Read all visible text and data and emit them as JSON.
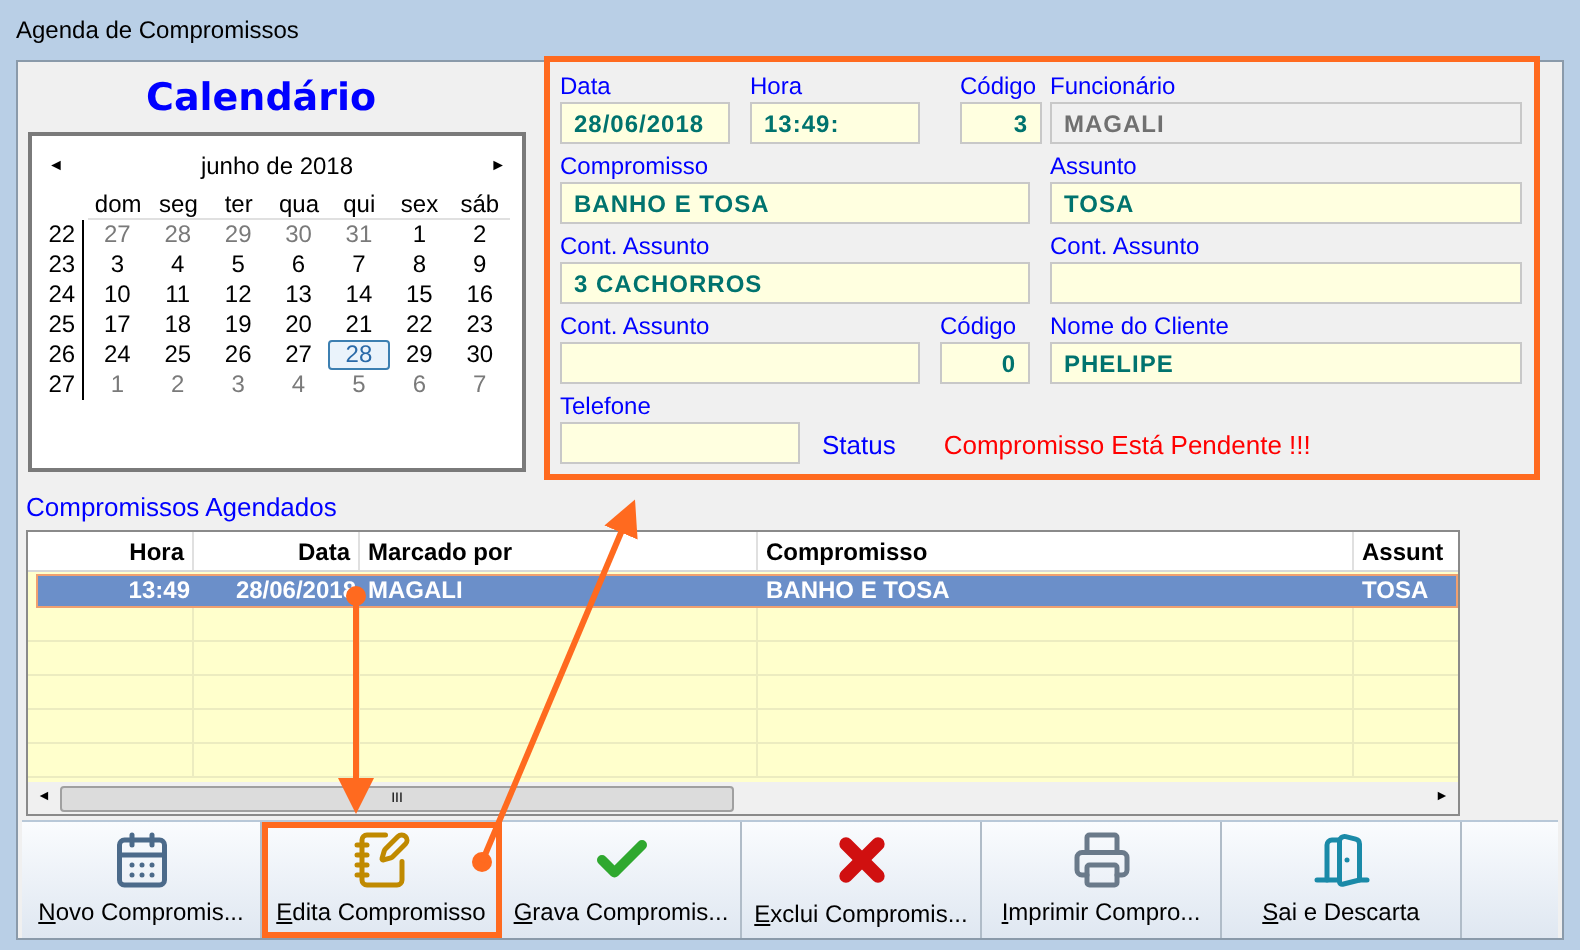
{
  "window": {
    "title": "Agenda de Compromissos"
  },
  "calendar": {
    "heading": "Calendário",
    "month": "junho de 2018",
    "prev": "◄",
    "next": "►",
    "weekdays": [
      "dom",
      "seg",
      "ter",
      "qua",
      "qui",
      "sex",
      "sáb"
    ],
    "weeks": [
      {
        "number": "22",
        "days": [
          {
            "day": "27",
            "other_month": true,
            "selected": false
          },
          {
            "day": "28",
            "other_month": true,
            "selected": false
          },
          {
            "day": "29",
            "other_month": true,
            "selected": false
          },
          {
            "day": "30",
            "other_month": true,
            "selected": false
          },
          {
            "day": "31",
            "other_month": true,
            "selected": false
          },
          {
            "day": "1",
            "other_month": false,
            "selected": false
          },
          {
            "day": "2",
            "other_month": false,
            "selected": false
          }
        ]
      },
      {
        "number": "23",
        "days": [
          {
            "day": "3",
            "other_month": false,
            "selected": false
          },
          {
            "day": "4",
            "other_month": false,
            "selected": false
          },
          {
            "day": "5",
            "other_month": false,
            "selected": false
          },
          {
            "day": "6",
            "other_month": false,
            "selected": false
          },
          {
            "day": "7",
            "other_month": false,
            "selected": false
          },
          {
            "day": "8",
            "other_month": false,
            "selected": false
          },
          {
            "day": "9",
            "other_month": false,
            "selected": false
          }
        ]
      },
      {
        "number": "24",
        "days": [
          {
            "day": "10",
            "other_month": false,
            "selected": false
          },
          {
            "day": "11",
            "other_month": false,
            "selected": false
          },
          {
            "day": "12",
            "other_month": false,
            "selected": false
          },
          {
            "day": "13",
            "other_month": false,
            "selected": false
          },
          {
            "day": "14",
            "other_month": false,
            "selected": false
          },
          {
            "day": "15",
            "other_month": false,
            "selected": false
          },
          {
            "day": "16",
            "other_month": false,
            "selected": false
          }
        ]
      },
      {
        "number": "25",
        "days": [
          {
            "day": "17",
            "other_month": false,
            "selected": false
          },
          {
            "day": "18",
            "other_month": false,
            "selected": false
          },
          {
            "day": "19",
            "other_month": false,
            "selected": false
          },
          {
            "day": "20",
            "other_month": false,
            "selected": false
          },
          {
            "day": "21",
            "other_month": false,
            "selected": false
          },
          {
            "day": "22",
            "other_month": false,
            "selected": false
          },
          {
            "day": "23",
            "other_month": false,
            "selected": false
          }
        ]
      },
      {
        "number": "26",
        "days": [
          {
            "day": "24",
            "other_month": false,
            "selected": false
          },
          {
            "day": "25",
            "other_month": false,
            "selected": false
          },
          {
            "day": "26",
            "other_month": false,
            "selected": false
          },
          {
            "day": "27",
            "other_month": false,
            "selected": false
          },
          {
            "day": "28",
            "other_month": false,
            "selected": true
          },
          {
            "day": "29",
            "other_month": false,
            "selected": false
          },
          {
            "day": "30",
            "other_month": false,
            "selected": false
          }
        ]
      },
      {
        "number": "27",
        "days": [
          {
            "day": "1",
            "other_month": true,
            "selected": false
          },
          {
            "day": "2",
            "other_month": true,
            "selected": false
          },
          {
            "day": "3",
            "other_month": true,
            "selected": false
          },
          {
            "day": "4",
            "other_month": true,
            "selected": false
          },
          {
            "day": "5",
            "other_month": true,
            "selected": false
          },
          {
            "day": "6",
            "other_month": true,
            "selected": false
          },
          {
            "day": "7",
            "other_month": true,
            "selected": false
          }
        ]
      }
    ]
  },
  "form": {
    "fields": [
      {
        "label": "Data",
        "value": "28/06/2018",
        "kind": "text",
        "disabled": false
      },
      {
        "label": "Hora",
        "value": "13:49:",
        "kind": "text",
        "disabled": false
      },
      {
        "label": "Código",
        "value": "3",
        "kind": "numeric",
        "disabled": false
      },
      {
        "label": "Funcionário",
        "value": "MAGALI",
        "kind": "text",
        "disabled": true
      },
      {
        "label": "Compromisso",
        "value": "BANHO E TOSA",
        "kind": "text",
        "disabled": false
      },
      {
        "label": "Assunto",
        "value": "TOSA",
        "kind": "text",
        "disabled": false
      },
      {
        "label": "Cont. Assunto",
        "value": "3 CACHORROS",
        "kind": "text",
        "disabled": false
      },
      {
        "label": "Cont. Assunto",
        "kind": "text",
        "disabled": false
      },
      {
        "label": "Cont. Assunto",
        "kind": "text",
        "disabled": false
      },
      {
        "label": "Código",
        "value": "0",
        "kind": "numeric",
        "disabled": false
      },
      {
        "label": "Nome do Cliente",
        "value": "PHELIPE",
        "kind": "text",
        "disabled": false
      },
      {
        "label": "Telefone",
        "kind": "text",
        "disabled": false
      }
    ],
    "status_label": "Status",
    "status_text": "Compromisso Está Pendente !!!"
  },
  "appointments": {
    "title": "Compromissos Agendados",
    "columns": [
      {
        "label": "Hora",
        "kind": "numeric"
      },
      {
        "label": "Data",
        "kind": "numeric"
      },
      {
        "label": "Marcado por",
        "kind": "text"
      },
      {
        "label": "Compromisso",
        "kind": "text"
      },
      {
        "label": "Assunt",
        "kind": "text"
      }
    ],
    "rows": [
      {
        "cells": [
          "13:49",
          "28/06/2018",
          "MAGALI",
          "BANHO E TOSA",
          "TOSA"
        ],
        "selected": true
      }
    ],
    "scroll_thumb": "III",
    "scroll_left": "◄",
    "scroll_right": "►"
  },
  "toolbar": [
    {
      "label": "Novo Compromis...",
      "kind": "new",
      "highlighted": false
    },
    {
      "label": "Edita Compromisso",
      "kind": "edit",
      "highlighted": true
    },
    {
      "label": "Grava Compromis...",
      "kind": "save",
      "highlighted": false
    },
    {
      "label": "Exclui Compromis...",
      "kind": "delete",
      "highlighted": false
    },
    {
      "label": "Imprimir Compro...",
      "kind": "print",
      "highlighted": false
    },
    {
      "label": "Sai e Descarta",
      "kind": "exit",
      "highlighted": false
    }
  ]
}
